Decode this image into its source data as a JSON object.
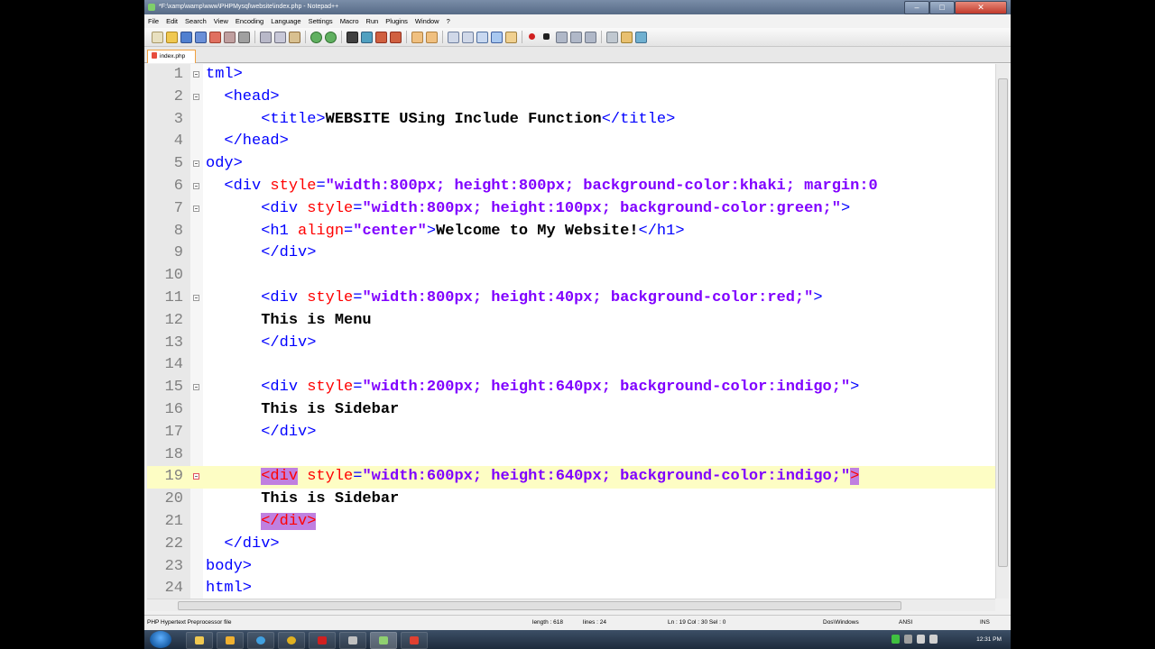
{
  "window": {
    "title": "*F:\\xamp\\wamp\\www\\PHPMysql\\website\\index.php - Notepad++",
    "min_label": "–",
    "max_label": "□",
    "close_label": "✕"
  },
  "menu": [
    "File",
    "Edit",
    "Search",
    "View",
    "Encoding",
    "Language",
    "Settings",
    "Macro",
    "Run",
    "Plugins",
    "Window",
    "?"
  ],
  "tab": {
    "label": "index.php"
  },
  "editor": {
    "current_line": 19,
    "lines": [
      {
        "n": "1",
        "fold": "box",
        "parts": [
          [
            "t",
            "tml>"
          ]
        ]
      },
      {
        "n": "2",
        "fold": "box",
        "parts": [
          [
            "p",
            "  "
          ],
          [
            "t",
            "<head>"
          ]
        ]
      },
      {
        "n": "3",
        "parts": [
          [
            "p",
            "      "
          ],
          [
            "t",
            "<title>"
          ],
          [
            "x",
            "WEBSITE USing Include Function"
          ],
          [
            "t",
            "</title>"
          ]
        ]
      },
      {
        "n": "4",
        "parts": [
          [
            "p",
            "  "
          ],
          [
            "t",
            "</head>"
          ]
        ]
      },
      {
        "n": "5",
        "fold": "box",
        "parts": [
          [
            "t",
            "ody>"
          ]
        ]
      },
      {
        "n": "6",
        "fold": "box",
        "parts": [
          [
            "p",
            "  "
          ],
          [
            "t",
            "<div "
          ],
          [
            "a",
            "style"
          ],
          [
            "t",
            "="
          ],
          [
            "v",
            "\"width:800px; height:800px; background-color:khaki; margin:0"
          ]
        ]
      },
      {
        "n": "7",
        "fold": "box",
        "parts": [
          [
            "p",
            "      "
          ],
          [
            "t",
            "<div "
          ],
          [
            "a",
            "style"
          ],
          [
            "t",
            "="
          ],
          [
            "v",
            "\"width:800px; height:100px; background-color:green;\""
          ],
          [
            "t",
            ">"
          ]
        ]
      },
      {
        "n": "8",
        "parts": [
          [
            "p",
            "      "
          ],
          [
            "t",
            "<h1 "
          ],
          [
            "a",
            "align"
          ],
          [
            "t",
            "="
          ],
          [
            "v",
            "\"center\""
          ],
          [
            "t",
            ">"
          ],
          [
            "x",
            "Welcome to My Website!"
          ],
          [
            "t",
            "</h1>"
          ]
        ]
      },
      {
        "n": "9",
        "parts": [
          [
            "p",
            "      "
          ],
          [
            "t",
            "</div>"
          ]
        ]
      },
      {
        "n": "10",
        "parts": []
      },
      {
        "n": "11",
        "fold": "box",
        "parts": [
          [
            "p",
            "      "
          ],
          [
            "t",
            "<div "
          ],
          [
            "a",
            "style"
          ],
          [
            "t",
            "="
          ],
          [
            "v",
            "\"width:800px; height:40px; background-color:red;\""
          ],
          [
            "t",
            ">"
          ]
        ]
      },
      {
        "n": "12",
        "parts": [
          [
            "p",
            "      "
          ],
          [
            "x",
            "This is Menu"
          ]
        ]
      },
      {
        "n": "13",
        "parts": [
          [
            "p",
            "      "
          ],
          [
            "t",
            "</div>"
          ]
        ]
      },
      {
        "n": "14",
        "parts": []
      },
      {
        "n": "15",
        "fold": "box",
        "parts": [
          [
            "p",
            "      "
          ],
          [
            "t",
            "<div "
          ],
          [
            "a",
            "style"
          ],
          [
            "t",
            "="
          ],
          [
            "v",
            "\"width:200px; height:640px; background-color:indigo;\""
          ],
          [
            "t",
            ">"
          ]
        ]
      },
      {
        "n": "16",
        "parts": [
          [
            "p",
            "      "
          ],
          [
            "x",
            "This is Sidebar"
          ]
        ]
      },
      {
        "n": "17",
        "parts": [
          [
            "p",
            "      "
          ],
          [
            "t",
            "</div>"
          ]
        ]
      },
      {
        "n": "18",
        "parts": []
      },
      {
        "n": "19",
        "fold": "box-red",
        "parts": [
          [
            "p",
            "      "
          ],
          [
            "h",
            "<div"
          ],
          [
            "t",
            " "
          ],
          [
            "a",
            "style"
          ],
          [
            "t",
            "="
          ],
          [
            "v",
            "\"width:600px; height:640px; background-color:indigo;\""
          ],
          [
            "h",
            ">"
          ]
        ]
      },
      {
        "n": "20",
        "parts": [
          [
            "p",
            "      "
          ],
          [
            "x",
            "This is Sidebar"
          ]
        ]
      },
      {
        "n": "21",
        "parts": [
          [
            "p",
            "      "
          ],
          [
            "h",
            "</div>"
          ]
        ]
      },
      {
        "n": "22",
        "parts": [
          [
            "p",
            "  "
          ],
          [
            "t",
            "</div>"
          ]
        ]
      },
      {
        "n": "23",
        "parts": [
          [
            "t",
            "body>"
          ]
        ]
      },
      {
        "n": "24",
        "parts": [
          [
            "t",
            "html>"
          ]
        ]
      }
    ]
  },
  "status": {
    "filetype": "PHP Hypertext Preprocessor file",
    "length": "length : 618",
    "lines": "lines : 24",
    "pos": "Ln : 19    Col : 30    Sel : 0",
    "eol": "Dos\\Windows",
    "encoding": "ANSI",
    "mode": "INS"
  },
  "taskbar": {
    "clock": "12:31 PM"
  },
  "colors": {
    "tag": "#0000ff",
    "attr": "#ff0000",
    "value": "#8000ff",
    "current_line": "#fdfdc4",
    "brace_match": "#c080e0"
  },
  "icons": [
    "app-icon",
    "new-file-icon",
    "open-file-icon",
    "save-icon",
    "save-all-icon",
    "close-icon",
    "print-icon",
    "cut-icon",
    "copy-icon",
    "paste-icon",
    "undo-icon",
    "redo-icon",
    "find-icon",
    "replace-icon",
    "zoom-in-icon",
    "zoom-out-icon",
    "sync-icon",
    "word-wrap-icon",
    "indent-guide-icon",
    "record-macro-icon",
    "stop-macro-icon",
    "play-macro-icon",
    "start-icon",
    "explorer-icon",
    "ie-icon",
    "chrome-icon",
    "filezilla-icon",
    "notepad-icon"
  ]
}
